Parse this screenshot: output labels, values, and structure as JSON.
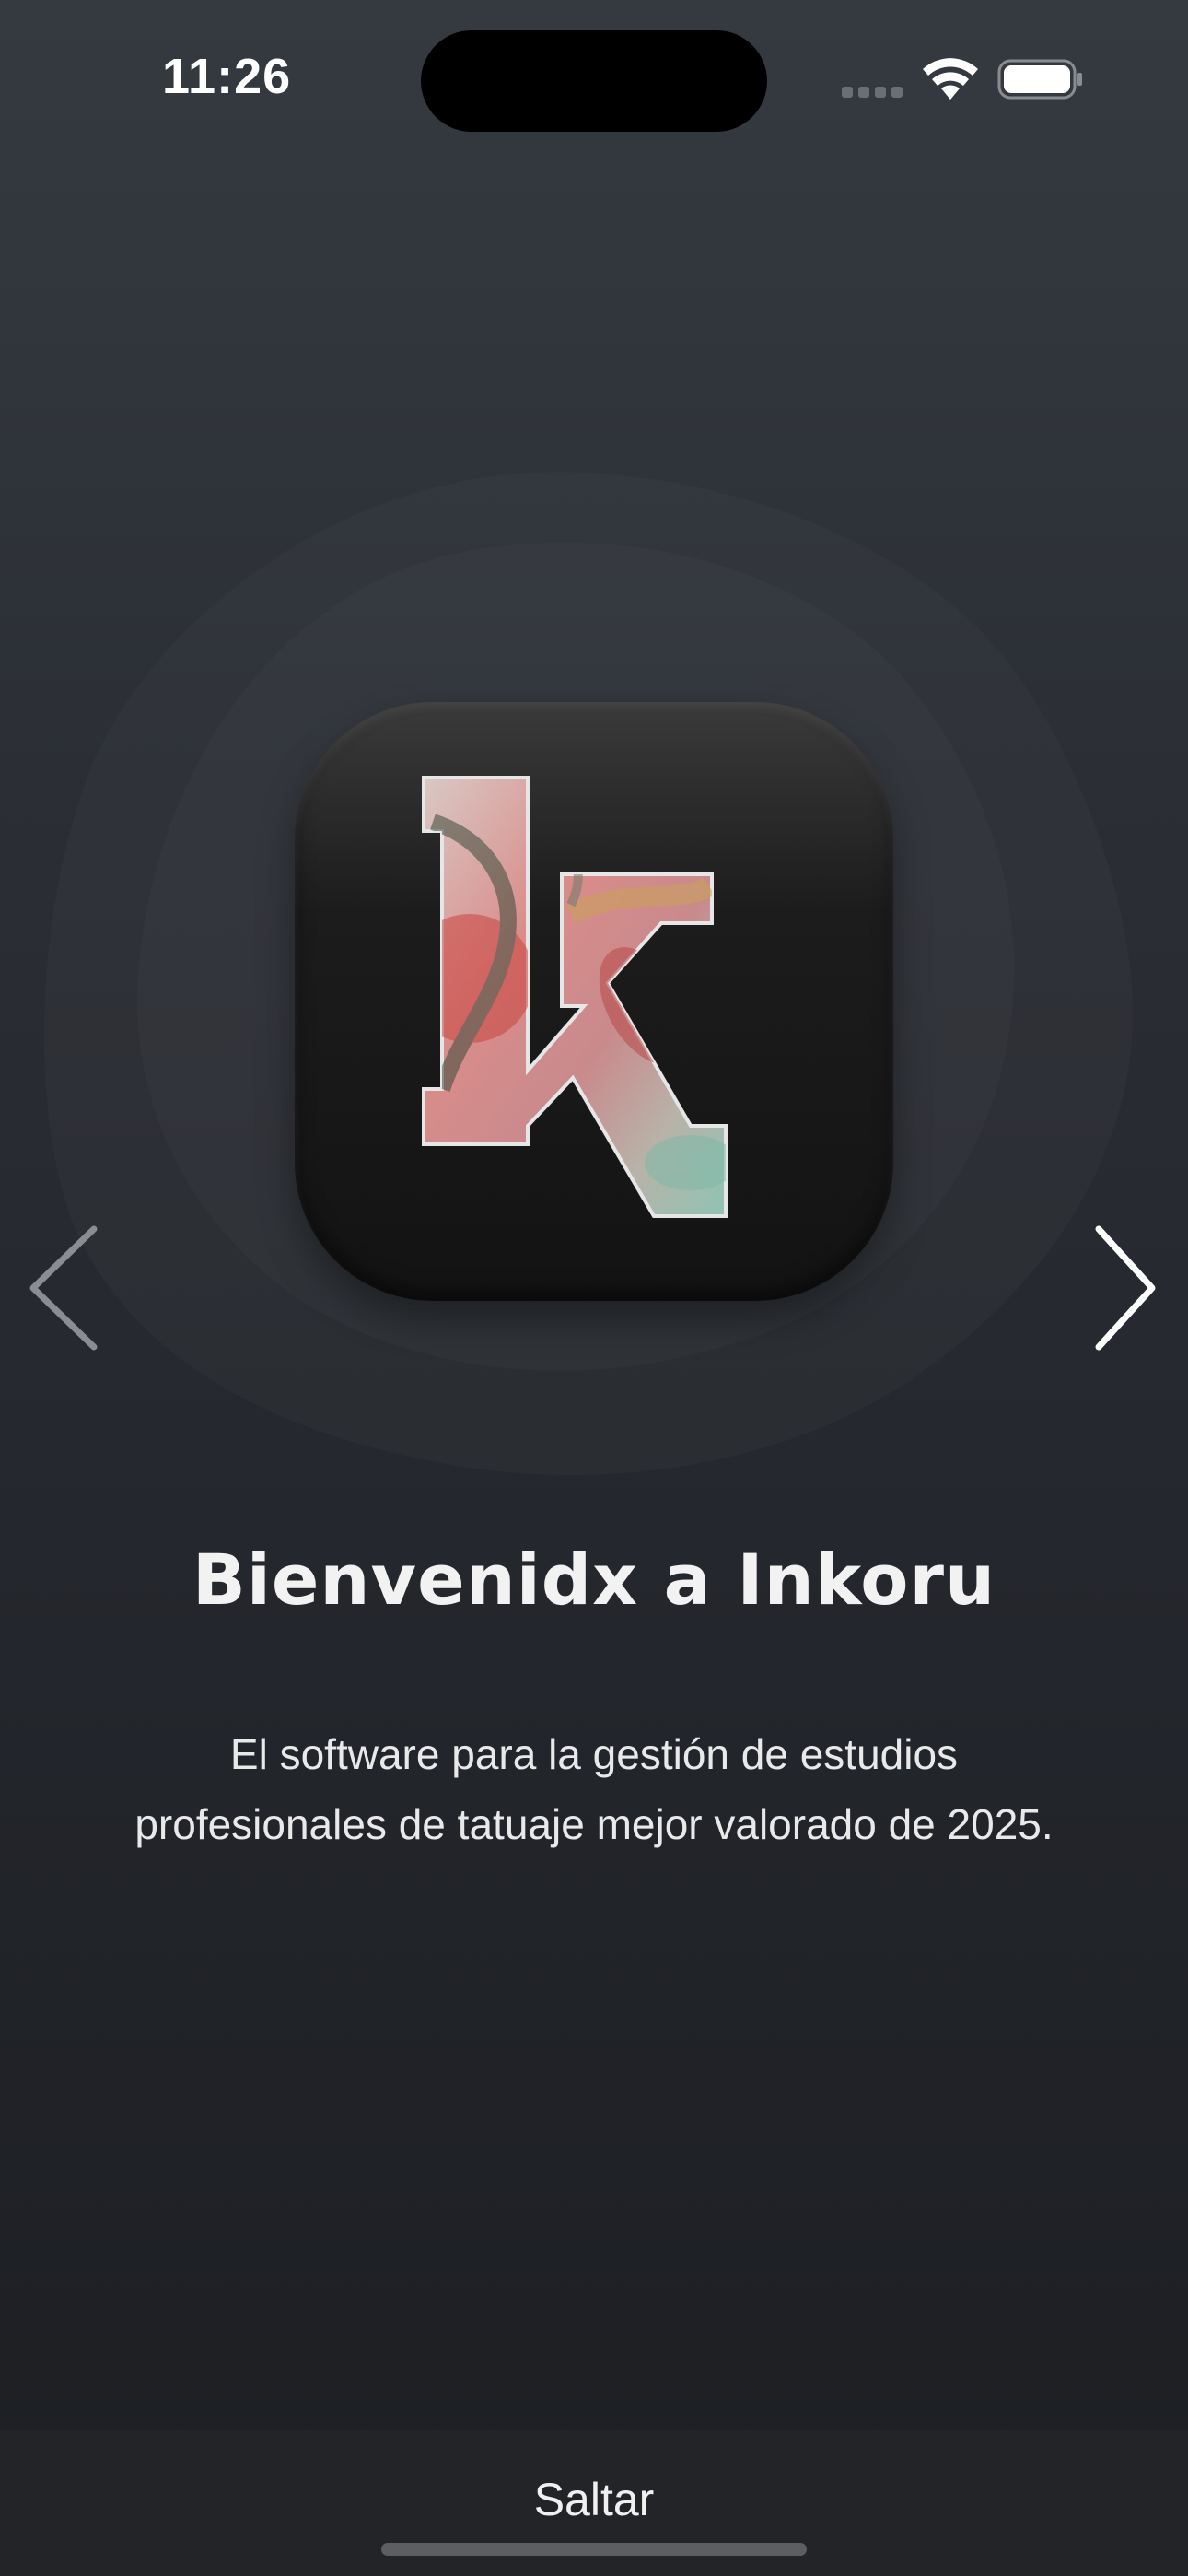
{
  "status_bar": {
    "time": "11:26",
    "wifi_icon": "wifi-icon",
    "battery_icon": "battery-icon",
    "signal_icon": "cellular-signal-icon"
  },
  "onboarding": {
    "logo_letter": "k",
    "logo_icon": "inkoru-app-logo",
    "prev_icon": "chevron-left-icon",
    "next_icon": "chevron-right-icon",
    "title": "Bienvenidx a Inkoru",
    "description": "El software para la gestión de estudios profesionales de tatuaje mejor valorado de 2025."
  },
  "footer": {
    "skip_label": "Saltar"
  },
  "colors": {
    "background_top": "#353a41",
    "background_bottom": "#1c1e22",
    "logo_tile": "#1a1a1a",
    "bottom_bar": "#232428",
    "text": "#ffffff"
  }
}
